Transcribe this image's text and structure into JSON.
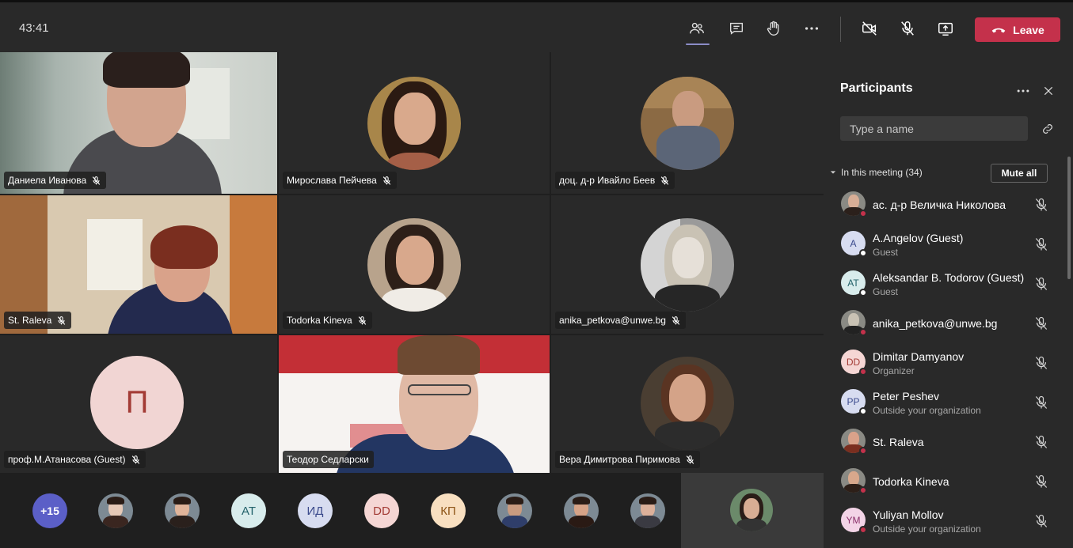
{
  "topbar": {
    "timer": "43:41",
    "leave_label": "Leave",
    "icons": [
      "participants-icon",
      "chat-icon",
      "raise-hand-icon",
      "more-icon",
      "camera-off-icon",
      "mic-off-icon",
      "share-screen-icon"
    ]
  },
  "tiles": [
    {
      "name": "Даниела Иванова"
    },
    {
      "name": "Мирослава Пейчева"
    },
    {
      "name": "доц. д-р Ивайло Беев"
    },
    {
      "name": "St. Raleva"
    },
    {
      "name": "Todorka Kineva"
    },
    {
      "name": "anika_petkova@unwe.bg"
    },
    {
      "name": "проф.М.Атанасова (Guest)",
      "initial": "П"
    },
    {
      "name": "Теодор Седларски"
    },
    {
      "name": "Вера Димитрова Пиримова"
    }
  ],
  "strip": {
    "overflow": "+15",
    "items": [
      {
        "type": "photo"
      },
      {
        "type": "photo"
      },
      {
        "type": "initials",
        "text": "AT",
        "bg": "#d8ecec",
        "fg": "#23626a"
      },
      {
        "type": "initials",
        "text": "ИД",
        "bg": "#d7dcf0",
        "fg": "#3b4a8c"
      },
      {
        "type": "initials",
        "text": "DD",
        "bg": "#f5d6d4",
        "fg": "#a33b35"
      },
      {
        "type": "initials",
        "text": "КП",
        "bg": "#f8dfc0",
        "fg": "#8d5517"
      },
      {
        "type": "photo"
      },
      {
        "type": "photo"
      },
      {
        "type": "photo"
      }
    ]
  },
  "panel": {
    "title": "Participants",
    "search_placeholder": "Type a name",
    "section_label": "In this meeting (34)",
    "mute_all_label": "Mute all",
    "participants": [
      {
        "name": "ас. д-р Величка Николова",
        "role": "",
        "avatar": "photo",
        "status": "#c4314b"
      },
      {
        "name": "A.Angelov (Guest)",
        "role": "Guest",
        "initials": "A",
        "bg": "#d7dcf0",
        "fg": "#3b4a8c",
        "status": "#ffffff"
      },
      {
        "name": "Aleksandar B. Todorov (Guest)",
        "role": "Guest",
        "initials": "AT",
        "bg": "#d8ecec",
        "fg": "#23626a",
        "status": "#ffffff"
      },
      {
        "name": "anika_petkova@unwe.bg",
        "role": "",
        "avatar": "photo",
        "status": "#c4314b"
      },
      {
        "name": "Dimitar Damyanov",
        "role": "Organizer",
        "initials": "DD",
        "bg": "#f5d6d4",
        "fg": "#a33b35",
        "status": "#c4314b"
      },
      {
        "name": "Peter Peshev",
        "role": "Outside your organization",
        "initials": "PP",
        "bg": "#d7dcf0",
        "fg": "#3b4a8c",
        "status": "#ffffff"
      },
      {
        "name": "St. Raleva",
        "role": "",
        "avatar": "photo",
        "status": "#c4314b"
      },
      {
        "name": "Todorka Kineva",
        "role": "",
        "avatar": "photo",
        "status": "#c4314b"
      },
      {
        "name": "Yuliyan Mollov",
        "role": "Outside your organization",
        "initials": "YM",
        "bg": "#f3d4e7",
        "fg": "#8a2f6a",
        "status": "#c4314b"
      }
    ]
  }
}
